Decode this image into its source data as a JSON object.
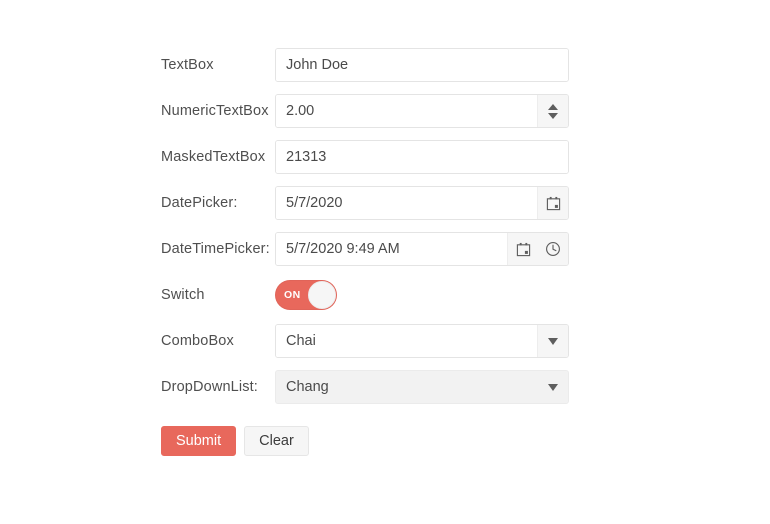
{
  "form": {
    "rows": [
      {
        "label": "TextBox",
        "value": "John Doe"
      },
      {
        "label": "NumericTextBox",
        "value": "2.00"
      },
      {
        "label": "MaskedTextBox",
        "value": "21313"
      },
      {
        "label": "DatePicker:",
        "value": "5/7/2020"
      },
      {
        "label": "DateTimePicker:",
        "value": "5/7/2020 9:49 AM"
      },
      {
        "label": "Switch",
        "value": "ON"
      },
      {
        "label": "ComboBox",
        "value": "Chai"
      },
      {
        "label": "DropDownList:",
        "value": "Chang"
      }
    ]
  },
  "buttons": {
    "submit_label": "Submit",
    "clear_label": "Clear"
  },
  "colors": {
    "accent": "#e8685c",
    "field_border": "#e4e4e4",
    "field_button_bg": "#f6f6f6",
    "dropdownlist_bg": "#f2f2f2",
    "text": "#4a4a4a",
    "label_text": "#4f4f4f",
    "page_bg": "#ffffff"
  },
  "icons": {
    "spinner_up": "triangle-up-icon",
    "spinner_down": "triangle-down-icon",
    "calendar": "calendar-icon",
    "clock": "clock-icon",
    "caret": "chevron-down-icon"
  }
}
